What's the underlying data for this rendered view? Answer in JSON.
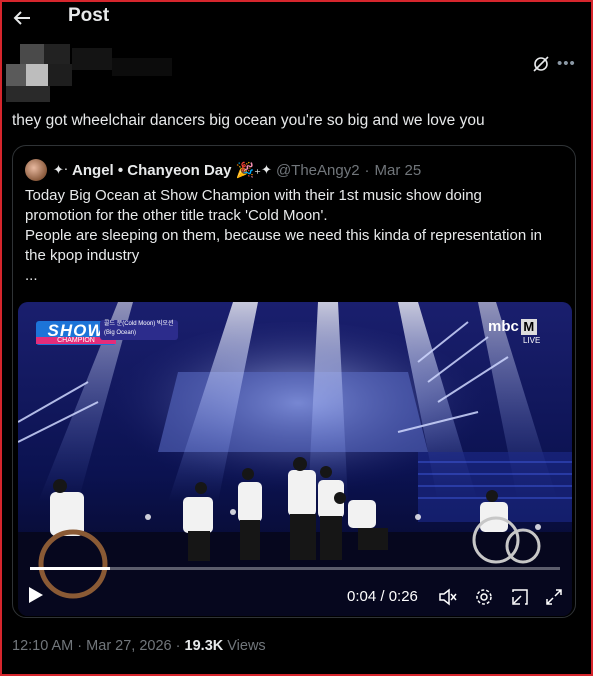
{
  "header": {
    "title": "Post"
  },
  "tweet": {
    "text": "they got wheelchair dancers big ocean you're so big and we love you"
  },
  "quote": {
    "author_name": "Angel • Chanyeon Day",
    "handle": "@TheAngy2",
    "separator": "·",
    "time": "Mar 25",
    "lines": [
      "Today Big Ocean at Show Champion with their 1st music show doing",
      "promotion for the other title track 'Cold Moon'.",
      "People are sleeping on them, because we need this kinda of representation in",
      "the kpop industry",
      "..."
    ]
  },
  "video": {
    "show_logo": "SHOW",
    "show_sub": "CHAMPION",
    "song_tag": "콜드 문(Cold Moon) 빅오션 (Big Ocean)",
    "broadcaster": "mbc",
    "broadcaster_m": "M",
    "live": "LIVE",
    "timecode": "0:04 / 0:26",
    "progress": 0.15
  },
  "footer": {
    "time": "12:10 AM",
    "dot1": "·",
    "date": "Mar 27, 2026",
    "dot2": "·",
    "views_count": "19.3K",
    "views_label": "Views"
  },
  "icons": {
    "back": "arrow-left-icon",
    "grok": "grok-icon",
    "more": "more-icon",
    "play": "play-icon",
    "mute": "mute-icon",
    "settings": "settings-icon",
    "pip": "picture-in-picture-icon",
    "fullscreen": "fullscreen-icon"
  },
  "colors": {
    "background": "#000000",
    "text": "#e7e9ea",
    "muted": "#71767b",
    "border": "#2f3336"
  }
}
